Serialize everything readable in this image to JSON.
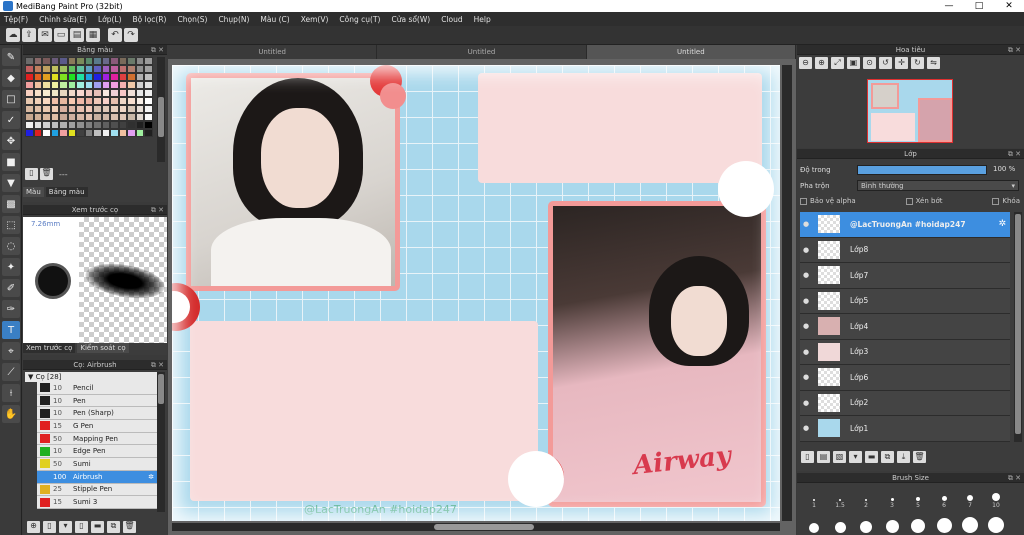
{
  "window": {
    "title": "MediBang Paint Pro (32bit)",
    "min": "—",
    "max": "□",
    "close": "✕"
  },
  "menu": [
    "Tệp(F)",
    "Chỉnh sửa(E)",
    "Lớp(L)",
    "Bộ lọc(R)",
    "Chọn(S)",
    "Chụp(N)",
    "Màu (C)",
    "Xem(V)",
    "Công cụ(T)",
    "Cửa sổ(W)",
    "Cloud",
    "Help"
  ],
  "panels": {
    "palette": {
      "title": "Bảng màu",
      "tab_color": "Màu",
      "tab_palette": "Bảng màu",
      "dash": "---"
    },
    "brush_preview": {
      "title": "Xem trước cọ",
      "size": "7.26mm",
      "tab_preview": "Xem trước cọ",
      "tab_control": "Kiểm soát cọ"
    },
    "brush_list": {
      "title": "Cọ: Airbrush",
      "group": "Cọ [28]"
    },
    "navigator": {
      "title": "Hoa tiêu"
    },
    "layers": {
      "title": "Lớp",
      "opacity_label": "Độ trong",
      "opacity_value": "100 %",
      "blend_label": "Pha trộn",
      "blend_value": "Bình thường",
      "protect_alpha": "Bảo vệ alpha",
      "clipping": "Xén bớt",
      "lock": "Khóa"
    },
    "brush_size": {
      "title": "Brush Size"
    }
  },
  "brushes": [
    {
      "size": "10",
      "name": "Pencil",
      "color": "#222222"
    },
    {
      "size": "10",
      "name": "Pen",
      "color": "#222222"
    },
    {
      "size": "10",
      "name": "Pen (Sharp)",
      "color": "#222222"
    },
    {
      "size": "15",
      "name": "G Pen",
      "color": "#e02020"
    },
    {
      "size": "50",
      "name": "Mapping Pen",
      "color": "#e02020"
    },
    {
      "size": "10",
      "name": "Edge Pen",
      "color": "#20b020"
    },
    {
      "size": "50",
      "name": "Sumi",
      "color": "#e0d020"
    },
    {
      "size": "100",
      "name": "Airbrush",
      "color": "#3d8ee0",
      "selected": true
    },
    {
      "size": "25",
      "name": "Stipple Pen",
      "color": "#e0b020"
    },
    {
      "size": "15",
      "name": "Sumi 3",
      "color": "#e02020"
    }
  ],
  "doc_tabs": [
    "Untitled",
    "Untitled",
    "Untitled"
  ],
  "canvas": {
    "text_print": "Airway",
    "watermark": "@LacTruongAn   #hoidap247"
  },
  "layers": [
    {
      "name": "@LacTruongAn   #hoidap247",
      "selected": true
    },
    {
      "name": "Lớp8"
    },
    {
      "name": "Lớp7"
    },
    {
      "name": "Lớp5"
    },
    {
      "name": "Lớp4"
    },
    {
      "name": "Lớp3"
    },
    {
      "name": "Lớp6"
    },
    {
      "name": "Lớp2"
    },
    {
      "name": "Lớp1"
    }
  ],
  "brush_sizes": [
    "1",
    "1.5",
    "2",
    "3",
    "5",
    "6",
    "7",
    "10"
  ],
  "palette_colors": [
    "#6b6b6b",
    "#8a6a6a",
    "#7a5a5a",
    "#6a5a7a",
    "#5a5a8a",
    "#8a7a5a",
    "#7a8a5a",
    "#5a8a6a",
    "#5a7a8a",
    "#6a6a8a",
    "#8a5a7a",
    "#7a6a5a",
    "#6a7a6a",
    "#8a8a8a",
    "#9a9a9a",
    "#c06060",
    "#c08060",
    "#c0a060",
    "#c0c060",
    "#a0c060",
    "#60c060",
    "#60c0a0",
    "#60a0c0",
    "#6060c0",
    "#a060c0",
    "#c060a0",
    "#c07070",
    "#b08070",
    "#909090",
    "#a0a0a0",
    "#e02020",
    "#e06020",
    "#e0a020",
    "#e0e020",
    "#80e020",
    "#20e020",
    "#20e0a0",
    "#20a0e0",
    "#2020e0",
    "#a020e0",
    "#e020a0",
    "#e04040",
    "#d07030",
    "#b0b0b0",
    "#c0c0c0",
    "#f0a0a0",
    "#f0c0a0",
    "#f0e0a0",
    "#f0f0a0",
    "#c0f0a0",
    "#a0f0a0",
    "#a0f0e0",
    "#a0e0f0",
    "#a0a0f0",
    "#e0a0f0",
    "#f0a0e0",
    "#f4b0b0",
    "#f0c8a8",
    "#d0d0d0",
    "#e0e0e0",
    "#f8d0c0",
    "#f8e0c8",
    "#f8ecd0",
    "#f0e8c8",
    "#e8d8c0",
    "#f0d8c8",
    "#f8d8d0",
    "#f0c8c0",
    "#e8c0b8",
    "#f8e8e0",
    "#f0d0d8",
    "#f8c8c8",
    "#f0e0d8",
    "#e8e8e8",
    "#f0f0f0",
    "#e8c8b0",
    "#f0d0b8",
    "#f8d8c0",
    "#f0c0a8",
    "#e8b8a0",
    "#f8c8b0",
    "#f0b8a8",
    "#e8b0a0",
    "#f0c8b8",
    "#f8d0c8",
    "#e8c0b0",
    "#f0d8c8",
    "#f8e0d0",
    "#f8f0e8",
    "#ffffff",
    "#d8b8a0",
    "#e0c0a8",
    "#e8c8b0",
    "#f0d0b8",
    "#d8b0a0",
    "#e0b8a8",
    "#e8c0b0",
    "#f0c8b8",
    "#d8c0b0",
    "#e0c8b8",
    "#e8d0c0",
    "#f0d8c8",
    "#d8c8b8",
    "#e8e0d8",
    "#f4f4f4",
    "#c8a890",
    "#d0b098",
    "#d8b8a0",
    "#e0c0a8",
    "#c8a898",
    "#d0b0a0",
    "#d8b8a8",
    "#e0c0b0",
    "#c8b0a0",
    "#d0b8a8",
    "#d8c0b0",
    "#e0c8b8",
    "#c8b8a8",
    "#e0d8d0",
    "#f8f8f8",
    "#f0f0f0",
    "#e0e0e0",
    "#d0d0d0",
    "#c0c0c0",
    "#b0b0b0",
    "#a0a0a0",
    "#909090",
    "#808080",
    "#707070",
    "#606060",
    "#505050",
    "#404040",
    "#303030",
    "#202020",
    "#000000",
    "#2020e0",
    "#e02020",
    "#ffffff",
    "#20a0e0",
    "#f0a0a0",
    "#e0e020",
    "#404040",
    "#808080",
    "#c0c0c0",
    "#f0f0f0",
    "#a0e0f0",
    "#f0c0a0",
    "#e0a0f0",
    "#a0f0a0",
    "#202020"
  ]
}
